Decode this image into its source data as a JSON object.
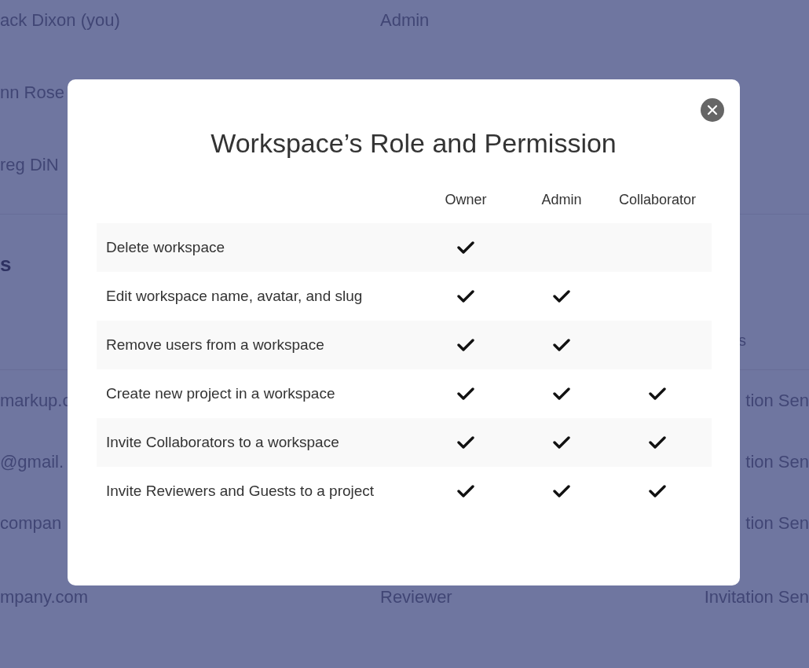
{
  "background": {
    "members": [
      {
        "name": "ack Dixon (you)",
        "role": "Admin"
      },
      {
        "name": "nn Rose"
      },
      {
        "name": "reg DiN"
      }
    ],
    "section_heading": "s",
    "status_header": "s",
    "invitations": [
      {
        "email": "markup.c",
        "status": "tion Sen"
      },
      {
        "email": "@gmail.",
        "status": "tion Sen"
      },
      {
        "email": "compan",
        "status": "tion Sen"
      },
      {
        "email": "mpany.com",
        "role": "Reviewer",
        "status": "Invitation Sen"
      }
    ]
  },
  "modal": {
    "title": "Workspace’s Role and Permission",
    "columns": [
      "Owner",
      "Admin",
      "Collaborator"
    ],
    "permissions": [
      {
        "label": "Delete workspace",
        "owner": true,
        "admin": false,
        "collaborator": false
      },
      {
        "label": "Edit workspace name, avatar, and slug",
        "owner": true,
        "admin": true,
        "collaborator": false
      },
      {
        "label": "Remove users from a workspace",
        "owner": true,
        "admin": true,
        "collaborator": false
      },
      {
        "label": "Create new project in a workspace",
        "owner": true,
        "admin": true,
        "collaborator": true
      },
      {
        "label": "Invite Collaborators to a workspace",
        "owner": true,
        "admin": true,
        "collaborator": true
      },
      {
        "label": "Invite Reviewers and Guests to a project",
        "owner": true,
        "admin": true,
        "collaborator": true
      }
    ]
  }
}
